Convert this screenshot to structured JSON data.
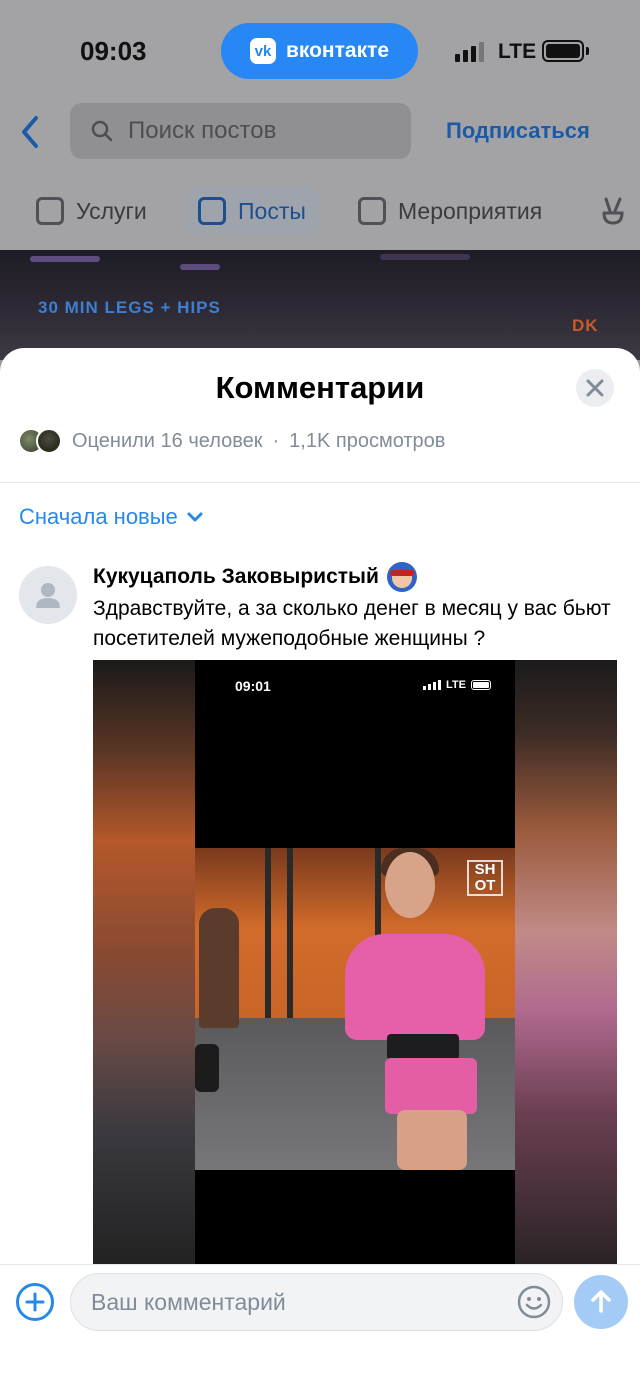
{
  "status_bar": {
    "time": "09:03",
    "app_pill_label": "вконтакте",
    "app_pill_logo": "vk",
    "network": "LTE",
    "accent_color": "#2787f5"
  },
  "header": {
    "search_placeholder": "Поиск постов",
    "subscribe_label": "Подписаться"
  },
  "tabs": [
    {
      "label": "Услуги",
      "icon": "calendar-check-icon",
      "active": false
    },
    {
      "label": "Посты",
      "icon": "document-icon",
      "active": true
    },
    {
      "label": "Мероприятия",
      "icon": "calendar-icon",
      "active": false
    },
    {
      "label": "",
      "icon": "victory-hand-icon",
      "active": false
    }
  ],
  "gym_banner": {
    "neon_left": "30 MIN LEGS + HIPS",
    "neon_right": "DK"
  },
  "comments_sheet": {
    "title": "Комментарии",
    "likes_text": "Оценили 16 человек",
    "separator": "·",
    "views_text": "1,1K просмотров",
    "sort_label": "Сначала новые"
  },
  "comment": {
    "author": "Кукуцаполь Заковыристый",
    "text": "Здравствуйте, а за сколько денег в месяц у вас бьют посетителей мужеподобные женщины ?",
    "media": {
      "phone_time": "09:01",
      "phone_network": "LTE",
      "watermark": "SH OT"
    }
  },
  "composer": {
    "placeholder": "Ваш комментарий"
  }
}
